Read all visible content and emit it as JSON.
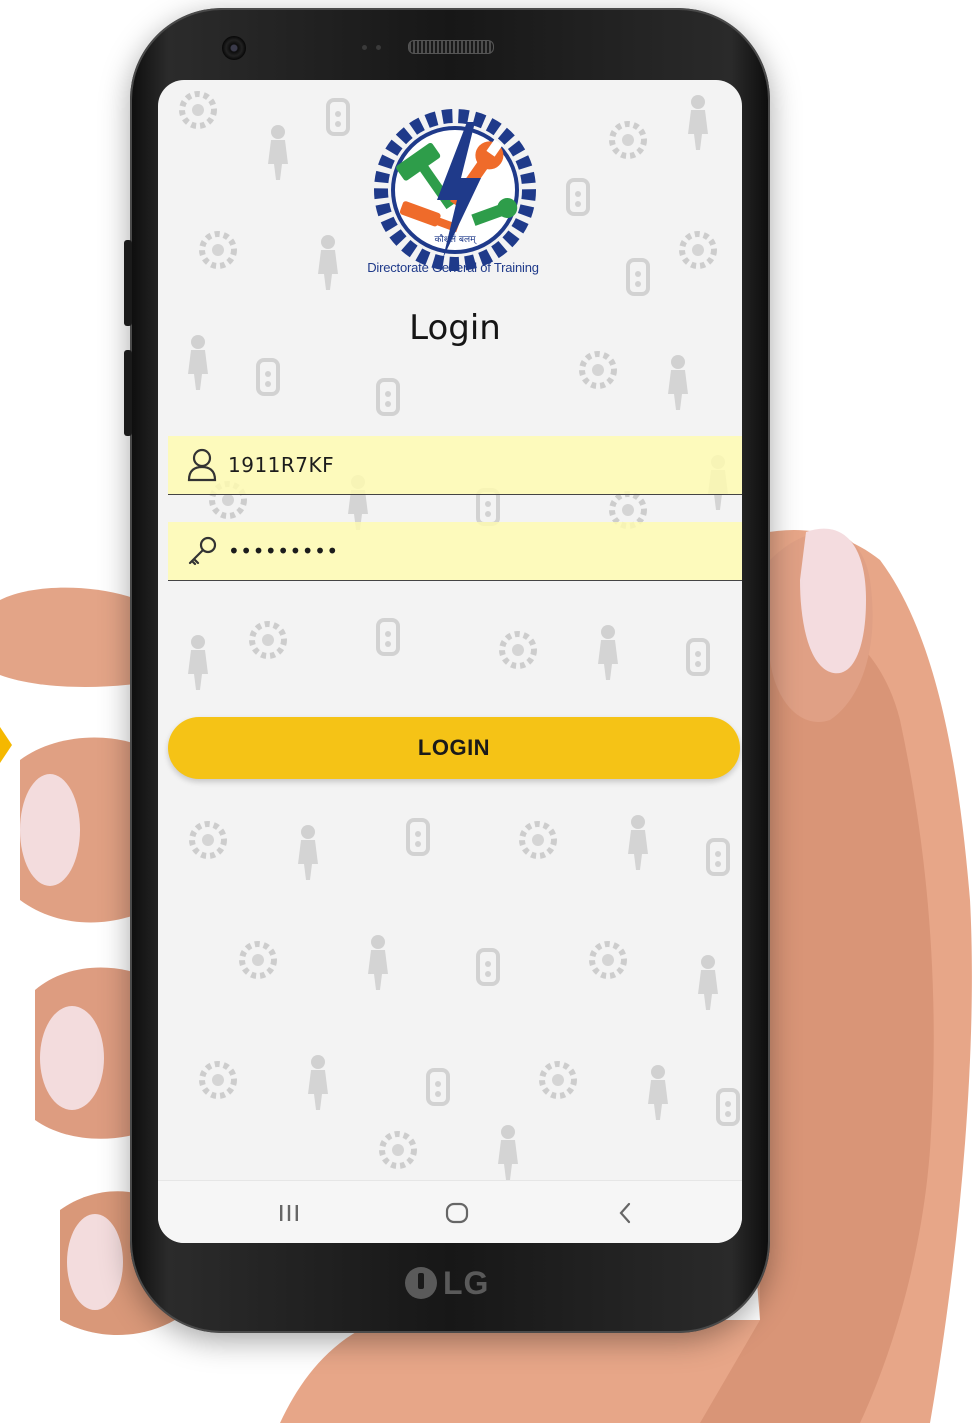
{
  "logo": {
    "emblem_text": "कौशलं बलम्",
    "caption": "Directorate General of Training"
  },
  "login_screen": {
    "title": "Login",
    "username_value": "1911R7KF",
    "password_value": "•••••••••",
    "login_button_label": "LOGIN"
  },
  "device": {
    "brand": "LG"
  },
  "icons": {
    "username": "user-icon",
    "password": "key-icon",
    "nav_recents": "recents-icon",
    "nav_home": "home-icon",
    "nav_back": "back-icon"
  },
  "colors": {
    "button": "#f5c316",
    "field_background": "#fffbb0",
    "logo_ring": "#1f3a8a",
    "logo_hammer": "#2e9d4a",
    "logo_wrench": "#ef6b2a"
  }
}
